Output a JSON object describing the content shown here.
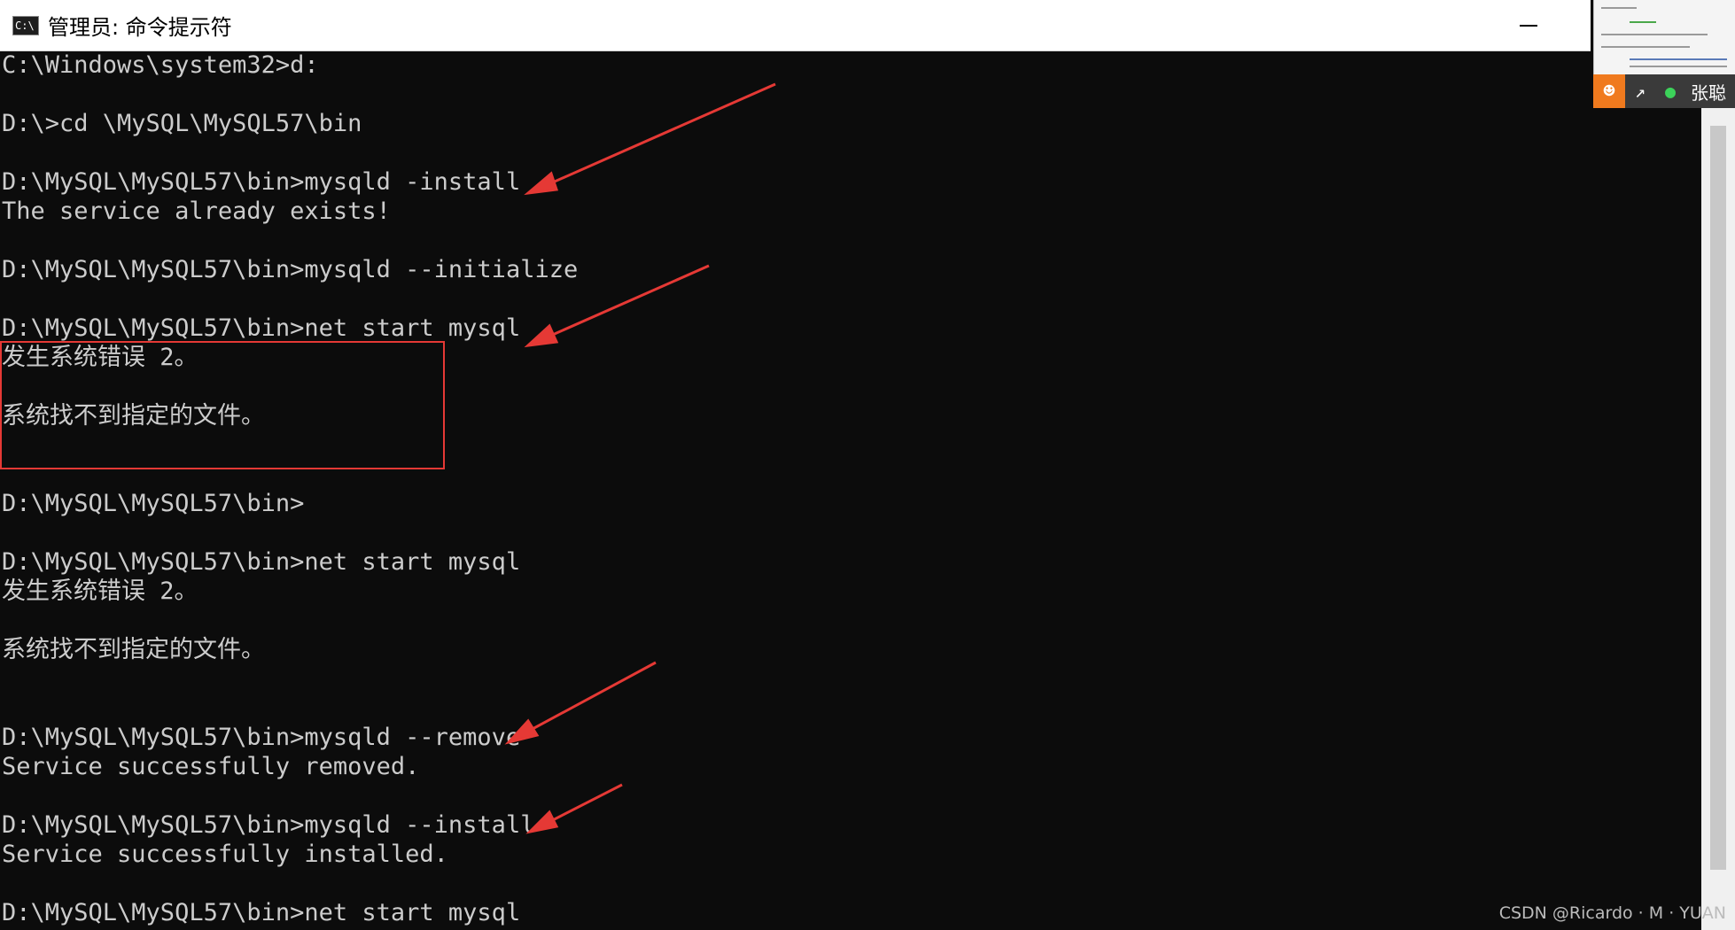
{
  "window": {
    "title": "管理员: 命令提示符",
    "icon": "cmd-icon"
  },
  "console_lines": [
    "C:\\Windows\\system32>d:",
    "",
    "D:\\>cd \\MySQL\\MySQL57\\bin",
    "",
    "D:\\MySQL\\MySQL57\\bin>mysqld -install",
    "The service already exists!",
    "",
    "D:\\MySQL\\MySQL57\\bin>mysqld --initialize",
    "",
    "D:\\MySQL\\MySQL57\\bin>net start mysql",
    "发生系统错误 2。",
    "",
    "系统找不到指定的文件。",
    "",
    "",
    "D:\\MySQL\\MySQL57\\bin>",
    "",
    "D:\\MySQL\\MySQL57\\bin>net start mysql",
    "发生系统错误 2。",
    "",
    "系统找不到指定的文件。",
    "",
    "",
    "D:\\MySQL\\MySQL57\\bin>mysqld --remove",
    "Service successfully removed.",
    "",
    "D:\\MySQL\\MySQL57\\bin>mysqld --install",
    "Service successfully installed.",
    "",
    "D:\\MySQL\\MySQL57\\bin>net start mysql"
  ],
  "meeting": {
    "name": "张聪"
  },
  "watermark": "CSDN @Ricardo · M · YUAN",
  "colors": {
    "console_bg": "#0c0c0c",
    "console_text": "#cccccc",
    "annotation_red": "#e53935"
  }
}
